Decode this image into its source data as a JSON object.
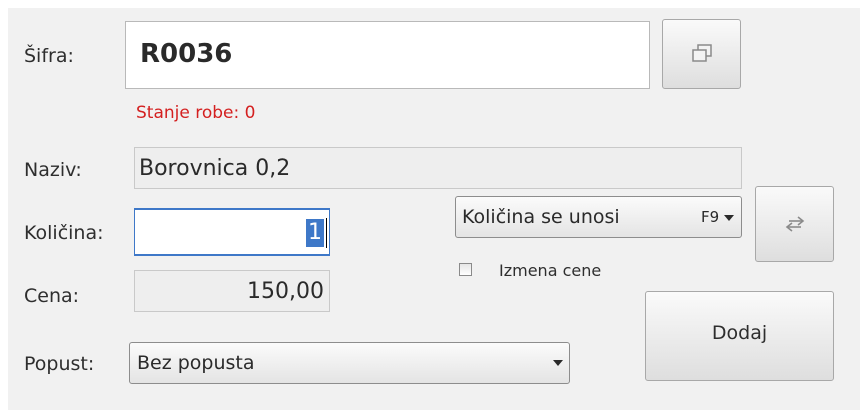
{
  "form": {
    "sifra": {
      "label": "Šifra:",
      "value": "R0036"
    },
    "stock": {
      "text": "Stanje robe: 0",
      "color": "#d42020"
    },
    "naziv": {
      "label": "Naziv:",
      "value": "Borovnica 0,2"
    },
    "kolicina": {
      "label": "Količina:",
      "value": "1"
    },
    "cena": {
      "label": "Cena:",
      "value": "150,00"
    },
    "popust": {
      "label": "Popust:",
      "selected": "Bez popusta"
    }
  },
  "mode_select": {
    "selected": "Količina se unosi",
    "shortcut": "F9"
  },
  "izmena_cene": {
    "label": "Izmena cene",
    "checked": false
  },
  "buttons": {
    "dodaj_label": "Dodaj"
  },
  "icons": {
    "lookup": "window-copy-icon",
    "swap": "swap-arrows-icon"
  }
}
